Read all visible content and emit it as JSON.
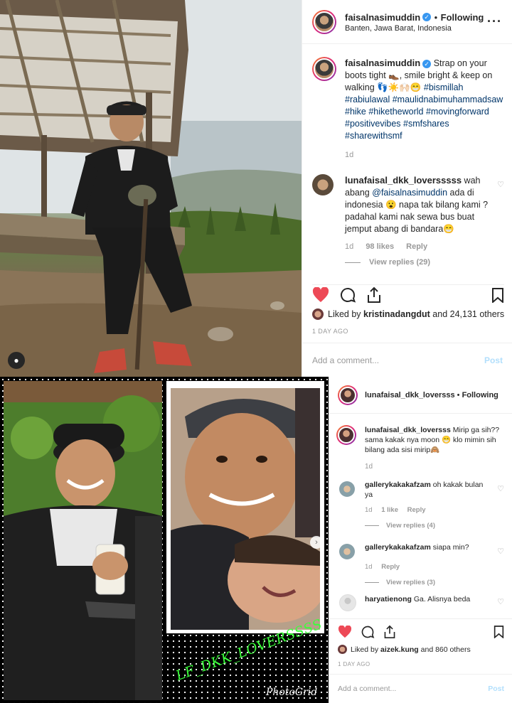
{
  "post1": {
    "username": "faisalnasimuddin",
    "following": "Following",
    "location": "Banten, Jawa Barat, Indonesia",
    "caption_user": "faisalnasimuddin",
    "caption_text": "Strap on your boots tight 👞, smile bright & keep on walking 👣☀️🙌🏻😁",
    "hashtags": "#bismillah #rabiulawal #maulidnabimuhammadsaw #hike #hiketheworld #movingforward #positivevibes #smfshares #sharewithsmf",
    "caption_time": "1d",
    "comment": {
      "user": "lunafaisal_dkk_loversssss",
      "text_1": "wah abang",
      "mention": "@faisalnasimuddin",
      "text_2": "ada di indonesia 😮 napa tak bilang kami ? padahal kami nak sewa bus buat jemput abang di bandara😁",
      "time": "1d",
      "likes": "98 likes",
      "reply": "Reply",
      "view_replies": "View replies (29)"
    },
    "liked_by_prefix": "Liked by",
    "liked_by_user": "kristinadangdut",
    "liked_by_suffix": "and 24,131 others",
    "date": "1 DAY AGO",
    "add_comment": "Add a comment...",
    "post_button": "Post"
  },
  "post2": {
    "username": "lunafaisal_dkk_loversss",
    "following": "Following",
    "caption_user": "lunafaisal_dkk_loversss",
    "caption_text": "Mirip ga sih?? sama kakak nya moon 😁 klo mimin sih bilang ada sisi mirip🙈",
    "caption_time": "1d",
    "comments": [
      {
        "user": "gallerykakakafzam",
        "text": "oh kakak bulan ya",
        "time": "1d",
        "likes": "1 like",
        "reply": "Reply",
        "view_replies": "View replies (4)"
      },
      {
        "user": "gallerykakakafzam",
        "text": "siapa min?",
        "time": "1d",
        "likes": "",
        "reply": "Reply",
        "view_replies": "View replies (3)"
      },
      {
        "user": "haryatienong",
        "text": "Ga. Alisnya beda"
      }
    ],
    "liked_by_prefix": "Liked by",
    "liked_by_user": "aizek.kung",
    "liked_by_suffix": "and 860 others",
    "date": "1 DAY AGO",
    "add_comment": "Add a comment...",
    "post_button": "Post"
  },
  "collage": {
    "watermark": "LF_DKK_LOVERSSSS",
    "app_name": "PhotoGrid"
  },
  "icons": {
    "heart": "heart-icon",
    "comment": "comment-icon",
    "share": "share-icon",
    "bookmark": "bookmark-icon",
    "more": "more-options-icon"
  },
  "colors": {
    "like_red": "#ed4956",
    "hashtag_blue": "#003569",
    "verified_blue": "#3897f0",
    "watermark_green": "#3cff3c"
  }
}
